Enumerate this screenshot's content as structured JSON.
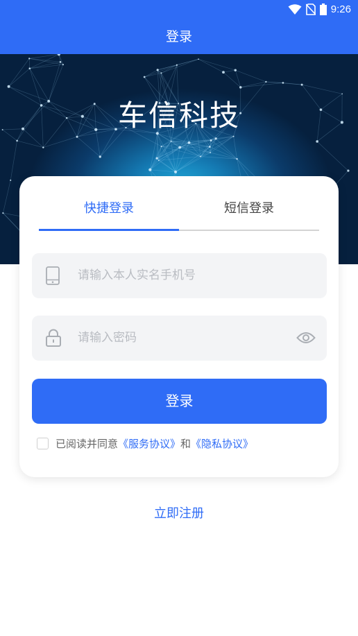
{
  "status_bar": {
    "time": "9:26"
  },
  "app_bar": {
    "title": "登录"
  },
  "hero": {
    "title": "车信科技"
  },
  "tabs": {
    "quick_login": "快捷登录",
    "sms_login": "短信登录"
  },
  "form": {
    "phone_placeholder": "请输入本人实名手机号",
    "password_placeholder": "请输入密码",
    "login_button": "登录"
  },
  "agreement": {
    "prefix": "已阅读并同意",
    "service_link": "《服务协议》",
    "conjunction": "和",
    "privacy_link": "《隐私协议》",
    "checked": false
  },
  "register_link": "立即注册",
  "colors": {
    "primary": "#2f6cf6",
    "placeholder": "#b9bcc2",
    "field_bg": "#f3f4f6"
  }
}
